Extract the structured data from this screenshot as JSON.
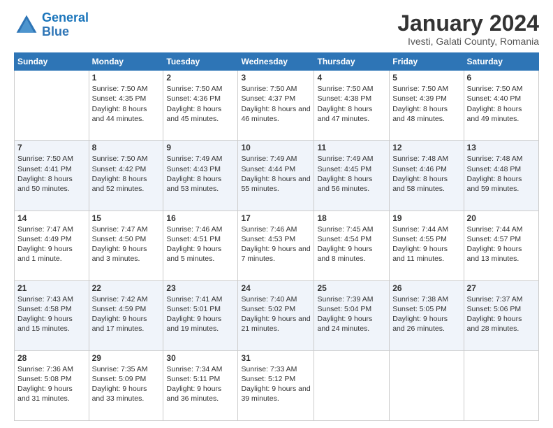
{
  "logo": {
    "line1": "General",
    "line2": "Blue"
  },
  "title": "January 2024",
  "location": "Ivesti, Galati County, Romania",
  "days_header": [
    "Sunday",
    "Monday",
    "Tuesday",
    "Wednesday",
    "Thursday",
    "Friday",
    "Saturday"
  ],
  "weeks": [
    [
      {
        "day": "",
        "sunrise": "",
        "sunset": "",
        "daylight": ""
      },
      {
        "day": "1",
        "sunrise": "Sunrise: 7:50 AM",
        "sunset": "Sunset: 4:35 PM",
        "daylight": "Daylight: 8 hours and 44 minutes."
      },
      {
        "day": "2",
        "sunrise": "Sunrise: 7:50 AM",
        "sunset": "Sunset: 4:36 PM",
        "daylight": "Daylight: 8 hours and 45 minutes."
      },
      {
        "day": "3",
        "sunrise": "Sunrise: 7:50 AM",
        "sunset": "Sunset: 4:37 PM",
        "daylight": "Daylight: 8 hours and 46 minutes."
      },
      {
        "day": "4",
        "sunrise": "Sunrise: 7:50 AM",
        "sunset": "Sunset: 4:38 PM",
        "daylight": "Daylight: 8 hours and 47 minutes."
      },
      {
        "day": "5",
        "sunrise": "Sunrise: 7:50 AM",
        "sunset": "Sunset: 4:39 PM",
        "daylight": "Daylight: 8 hours and 48 minutes."
      },
      {
        "day": "6",
        "sunrise": "Sunrise: 7:50 AM",
        "sunset": "Sunset: 4:40 PM",
        "daylight": "Daylight: 8 hours and 49 minutes."
      }
    ],
    [
      {
        "day": "7",
        "sunrise": "Sunrise: 7:50 AM",
        "sunset": "Sunset: 4:41 PM",
        "daylight": "Daylight: 8 hours and 50 minutes."
      },
      {
        "day": "8",
        "sunrise": "Sunrise: 7:50 AM",
        "sunset": "Sunset: 4:42 PM",
        "daylight": "Daylight: 8 hours and 52 minutes."
      },
      {
        "day": "9",
        "sunrise": "Sunrise: 7:49 AM",
        "sunset": "Sunset: 4:43 PM",
        "daylight": "Daylight: 8 hours and 53 minutes."
      },
      {
        "day": "10",
        "sunrise": "Sunrise: 7:49 AM",
        "sunset": "Sunset: 4:44 PM",
        "daylight": "Daylight: 8 hours and 55 minutes."
      },
      {
        "day": "11",
        "sunrise": "Sunrise: 7:49 AM",
        "sunset": "Sunset: 4:45 PM",
        "daylight": "Daylight: 8 hours and 56 minutes."
      },
      {
        "day": "12",
        "sunrise": "Sunrise: 7:48 AM",
        "sunset": "Sunset: 4:46 PM",
        "daylight": "Daylight: 8 hours and 58 minutes."
      },
      {
        "day": "13",
        "sunrise": "Sunrise: 7:48 AM",
        "sunset": "Sunset: 4:48 PM",
        "daylight": "Daylight: 8 hours and 59 minutes."
      }
    ],
    [
      {
        "day": "14",
        "sunrise": "Sunrise: 7:47 AM",
        "sunset": "Sunset: 4:49 PM",
        "daylight": "Daylight: 9 hours and 1 minute."
      },
      {
        "day": "15",
        "sunrise": "Sunrise: 7:47 AM",
        "sunset": "Sunset: 4:50 PM",
        "daylight": "Daylight: 9 hours and 3 minutes."
      },
      {
        "day": "16",
        "sunrise": "Sunrise: 7:46 AM",
        "sunset": "Sunset: 4:51 PM",
        "daylight": "Daylight: 9 hours and 5 minutes."
      },
      {
        "day": "17",
        "sunrise": "Sunrise: 7:46 AM",
        "sunset": "Sunset: 4:53 PM",
        "daylight": "Daylight: 9 hours and 7 minutes."
      },
      {
        "day": "18",
        "sunrise": "Sunrise: 7:45 AM",
        "sunset": "Sunset: 4:54 PM",
        "daylight": "Daylight: 9 hours and 8 minutes."
      },
      {
        "day": "19",
        "sunrise": "Sunrise: 7:44 AM",
        "sunset": "Sunset: 4:55 PM",
        "daylight": "Daylight: 9 hours and 11 minutes."
      },
      {
        "day": "20",
        "sunrise": "Sunrise: 7:44 AM",
        "sunset": "Sunset: 4:57 PM",
        "daylight": "Daylight: 9 hours and 13 minutes."
      }
    ],
    [
      {
        "day": "21",
        "sunrise": "Sunrise: 7:43 AM",
        "sunset": "Sunset: 4:58 PM",
        "daylight": "Daylight: 9 hours and 15 minutes."
      },
      {
        "day": "22",
        "sunrise": "Sunrise: 7:42 AM",
        "sunset": "Sunset: 4:59 PM",
        "daylight": "Daylight: 9 hours and 17 minutes."
      },
      {
        "day": "23",
        "sunrise": "Sunrise: 7:41 AM",
        "sunset": "Sunset: 5:01 PM",
        "daylight": "Daylight: 9 hours and 19 minutes."
      },
      {
        "day": "24",
        "sunrise": "Sunrise: 7:40 AM",
        "sunset": "Sunset: 5:02 PM",
        "daylight": "Daylight: 9 hours and 21 minutes."
      },
      {
        "day": "25",
        "sunrise": "Sunrise: 7:39 AM",
        "sunset": "Sunset: 5:04 PM",
        "daylight": "Daylight: 9 hours and 24 minutes."
      },
      {
        "day": "26",
        "sunrise": "Sunrise: 7:38 AM",
        "sunset": "Sunset: 5:05 PM",
        "daylight": "Daylight: 9 hours and 26 minutes."
      },
      {
        "day": "27",
        "sunrise": "Sunrise: 7:37 AM",
        "sunset": "Sunset: 5:06 PM",
        "daylight": "Daylight: 9 hours and 28 minutes."
      }
    ],
    [
      {
        "day": "28",
        "sunrise": "Sunrise: 7:36 AM",
        "sunset": "Sunset: 5:08 PM",
        "daylight": "Daylight: 9 hours and 31 minutes."
      },
      {
        "day": "29",
        "sunrise": "Sunrise: 7:35 AM",
        "sunset": "Sunset: 5:09 PM",
        "daylight": "Daylight: 9 hours and 33 minutes."
      },
      {
        "day": "30",
        "sunrise": "Sunrise: 7:34 AM",
        "sunset": "Sunset: 5:11 PM",
        "daylight": "Daylight: 9 hours and 36 minutes."
      },
      {
        "day": "31",
        "sunrise": "Sunrise: 7:33 AM",
        "sunset": "Sunset: 5:12 PM",
        "daylight": "Daylight: 9 hours and 39 minutes."
      },
      {
        "day": "",
        "sunrise": "",
        "sunset": "",
        "daylight": ""
      },
      {
        "day": "",
        "sunrise": "",
        "sunset": "",
        "daylight": ""
      },
      {
        "day": "",
        "sunrise": "",
        "sunset": "",
        "daylight": ""
      }
    ]
  ]
}
